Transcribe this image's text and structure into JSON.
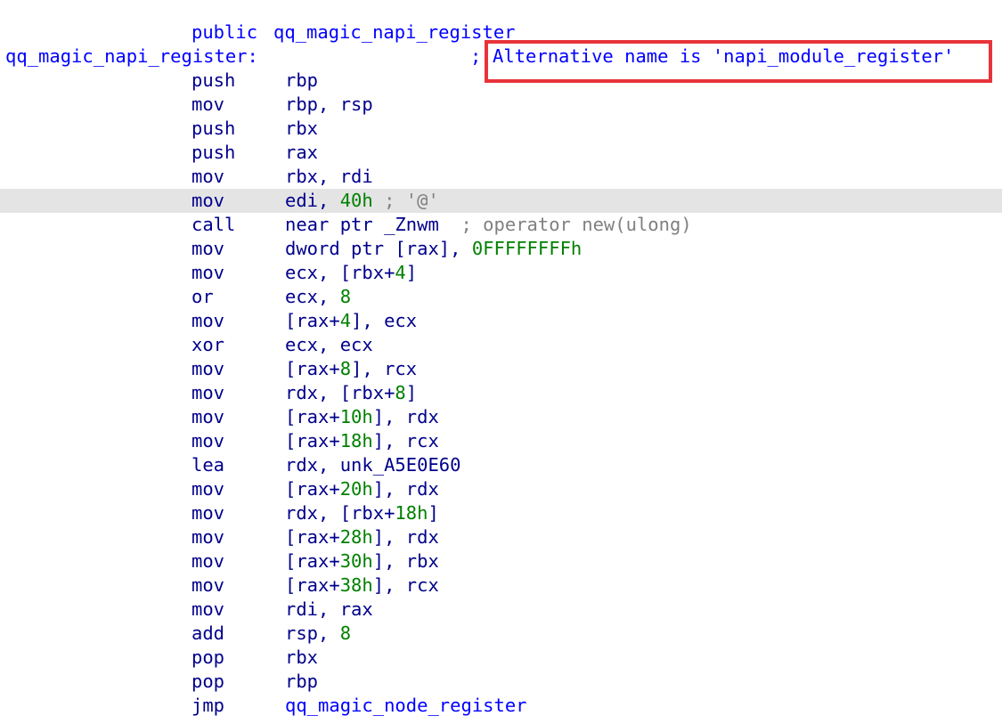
{
  "window": {
    "kind": "disassembly-listing"
  },
  "colors": {
    "keyword": "#0000ff",
    "text": "#00008b",
    "number": "#008000",
    "comment": "#808080",
    "highlight_row": "#e4e4e4",
    "annotation_box": "#e8333a"
  },
  "highlighted_line_index": 7,
  "lines": [
    {
      "segments": [
        {
          "col": "mnem",
          "text": "public ",
          "class": "blue"
        },
        {
          "col": "name",
          "text": "qq_magic_napi_register",
          "class": "blue"
        }
      ]
    },
    {
      "segments": [
        {
          "col": "label",
          "text": "qq_magic_napi_register:",
          "class": "blue"
        },
        {
          "col": "cmt",
          "text": "; ",
          "class": "blue"
        },
        {
          "col": "cmt2",
          "text": "Alternative name is 'napi_module_register'",
          "class": "blue"
        }
      ]
    },
    {
      "segments": [
        {
          "col": "mnem",
          "text": "push",
          "class": "navy"
        },
        {
          "col": "op",
          "text": "rbp",
          "class": "navy"
        }
      ]
    },
    {
      "segments": [
        {
          "col": "mnem",
          "text": "mov",
          "class": "navy"
        },
        {
          "col": "op",
          "text": "rbp, rsp",
          "class": "navy"
        }
      ]
    },
    {
      "segments": [
        {
          "col": "mnem",
          "text": "push",
          "class": "navy"
        },
        {
          "col": "op",
          "text": "rbx",
          "class": "navy"
        }
      ]
    },
    {
      "segments": [
        {
          "col": "mnem",
          "text": "push",
          "class": "navy"
        },
        {
          "col": "op",
          "text": "rax",
          "class": "navy"
        }
      ]
    },
    {
      "segments": [
        {
          "col": "mnem",
          "text": "mov",
          "class": "navy"
        },
        {
          "col": "op",
          "text": "rbx, rdi",
          "class": "navy"
        }
      ]
    },
    {
      "segments": [
        {
          "col": "mnem",
          "text": "mov",
          "class": "navy"
        },
        {
          "col": "op",
          "text": "edi, ",
          "class": "navy"
        },
        {
          "text": "40h",
          "class": "green"
        },
        {
          "text": " ; '@'",
          "class": "gray"
        }
      ]
    },
    {
      "segments": [
        {
          "col": "mnem",
          "text": "call",
          "class": "navy"
        },
        {
          "col": "op",
          "text": "near ptr _Znwm",
          "class": "navy"
        },
        {
          "text": "  ; operator new(ulong)",
          "class": "gray"
        }
      ]
    },
    {
      "segments": [
        {
          "col": "mnem",
          "text": "mov",
          "class": "navy"
        },
        {
          "col": "op",
          "text": "dword ptr [rax], ",
          "class": "navy"
        },
        {
          "text": "0FFFFFFFFh",
          "class": "green"
        }
      ]
    },
    {
      "segments": [
        {
          "col": "mnem",
          "text": "mov",
          "class": "navy"
        },
        {
          "col": "op",
          "text": "ecx, [rbx+",
          "class": "navy"
        },
        {
          "text": "4",
          "class": "green"
        },
        {
          "text": "]",
          "class": "navy"
        }
      ]
    },
    {
      "segments": [
        {
          "col": "mnem",
          "text": "or",
          "class": "navy"
        },
        {
          "col": "op",
          "text": "ecx, ",
          "class": "navy"
        },
        {
          "text": "8",
          "class": "green"
        }
      ]
    },
    {
      "segments": [
        {
          "col": "mnem",
          "text": "mov",
          "class": "navy"
        },
        {
          "col": "op",
          "text": "[rax+",
          "class": "navy"
        },
        {
          "text": "4",
          "class": "green"
        },
        {
          "text": "], ecx",
          "class": "navy"
        }
      ]
    },
    {
      "segments": [
        {
          "col": "mnem",
          "text": "xor",
          "class": "navy"
        },
        {
          "col": "op",
          "text": "ecx, ecx",
          "class": "navy"
        }
      ]
    },
    {
      "segments": [
        {
          "col": "mnem",
          "text": "mov",
          "class": "navy"
        },
        {
          "col": "op",
          "text": "[rax+",
          "class": "navy"
        },
        {
          "text": "8",
          "class": "green"
        },
        {
          "text": "], rcx",
          "class": "navy"
        }
      ]
    },
    {
      "segments": [
        {
          "col": "mnem",
          "text": "mov",
          "class": "navy"
        },
        {
          "col": "op",
          "text": "rdx, [rbx+",
          "class": "navy"
        },
        {
          "text": "8",
          "class": "green"
        },
        {
          "text": "]",
          "class": "navy"
        }
      ]
    },
    {
      "segments": [
        {
          "col": "mnem",
          "text": "mov",
          "class": "navy"
        },
        {
          "col": "op",
          "text": "[rax+",
          "class": "navy"
        },
        {
          "text": "10h",
          "class": "green"
        },
        {
          "text": "], rdx",
          "class": "navy"
        }
      ]
    },
    {
      "segments": [
        {
          "col": "mnem",
          "text": "mov",
          "class": "navy"
        },
        {
          "col": "op",
          "text": "[rax+",
          "class": "navy"
        },
        {
          "text": "18h",
          "class": "green"
        },
        {
          "text": "], rcx",
          "class": "navy"
        }
      ]
    },
    {
      "segments": [
        {
          "col": "mnem",
          "text": "lea",
          "class": "navy"
        },
        {
          "col": "op",
          "text": "rdx, unk_A5E0E60",
          "class": "navy"
        }
      ]
    },
    {
      "segments": [
        {
          "col": "mnem",
          "text": "mov",
          "class": "navy"
        },
        {
          "col": "op",
          "text": "[rax+",
          "class": "navy"
        },
        {
          "text": "20h",
          "class": "green"
        },
        {
          "text": "], rdx",
          "class": "navy"
        }
      ]
    },
    {
      "segments": [
        {
          "col": "mnem",
          "text": "mov",
          "class": "navy"
        },
        {
          "col": "op",
          "text": "rdx, [rbx+",
          "class": "navy"
        },
        {
          "text": "18h",
          "class": "green"
        },
        {
          "text": "]",
          "class": "navy"
        }
      ]
    },
    {
      "segments": [
        {
          "col": "mnem",
          "text": "mov",
          "class": "navy"
        },
        {
          "col": "op",
          "text": "[rax+",
          "class": "navy"
        },
        {
          "text": "28h",
          "class": "green"
        },
        {
          "text": "], rdx",
          "class": "navy"
        }
      ]
    },
    {
      "segments": [
        {
          "col": "mnem",
          "text": "mov",
          "class": "navy"
        },
        {
          "col": "op",
          "text": "[rax+",
          "class": "navy"
        },
        {
          "text": "30h",
          "class": "green"
        },
        {
          "text": "], rbx",
          "class": "navy"
        }
      ]
    },
    {
      "segments": [
        {
          "col": "mnem",
          "text": "mov",
          "class": "navy"
        },
        {
          "col": "op",
          "text": "[rax+",
          "class": "navy"
        },
        {
          "text": "38h",
          "class": "green"
        },
        {
          "text": "], rcx",
          "class": "navy"
        }
      ]
    },
    {
      "segments": [
        {
          "col": "mnem",
          "text": "mov",
          "class": "navy"
        },
        {
          "col": "op",
          "text": "rdi, rax",
          "class": "navy"
        }
      ]
    },
    {
      "segments": [
        {
          "col": "mnem",
          "text": "add",
          "class": "navy"
        },
        {
          "col": "op",
          "text": "rsp, ",
          "class": "navy"
        },
        {
          "text": "8",
          "class": "green"
        }
      ]
    },
    {
      "segments": [
        {
          "col": "mnem",
          "text": "pop",
          "class": "navy"
        },
        {
          "col": "op",
          "text": "rbx",
          "class": "navy"
        }
      ]
    },
    {
      "segments": [
        {
          "col": "mnem",
          "text": "pop",
          "class": "navy"
        },
        {
          "col": "op",
          "text": "rbp",
          "class": "navy"
        }
      ]
    },
    {
      "segments": [
        {
          "col": "mnem",
          "text": "jmp",
          "class": "navy"
        },
        {
          "col": "op",
          "text": "qq_magic_node_register",
          "class": "blue"
        }
      ]
    }
  ]
}
